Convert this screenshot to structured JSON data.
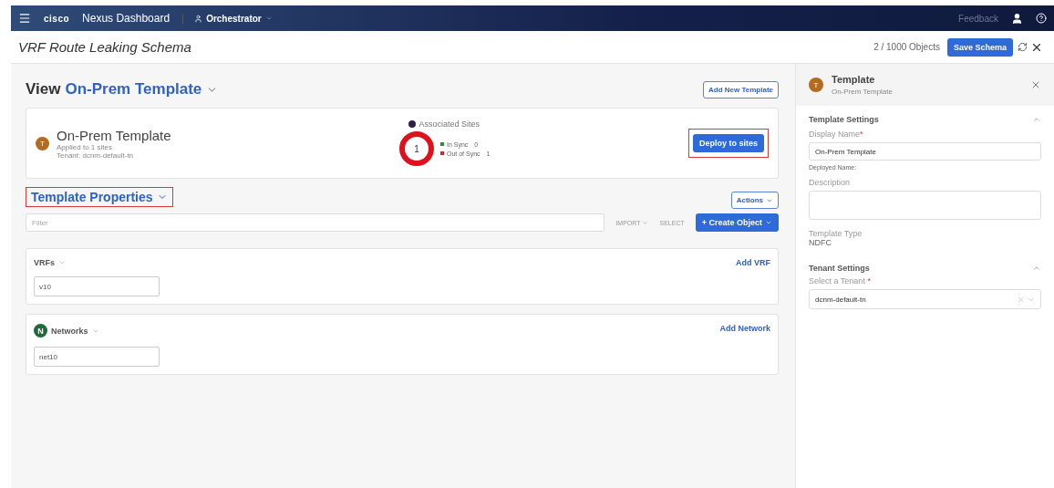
{
  "topbar": {
    "brand": "cisco",
    "product": "Nexus Dashboard",
    "app": "Orchestrator",
    "feedback": "Feedback"
  },
  "header": {
    "title": "VRF Route Leaking Schema",
    "objects": "2 / 1000 Objects",
    "save": "Save Schema"
  },
  "view": {
    "prefix": "View",
    "name": "On-Prem Template",
    "add_button": "Add New Template"
  },
  "template_card": {
    "avatar": "T",
    "name": "On-Prem Template",
    "applied": "Applied to 1 sites",
    "tenant": "Tenant: dcnm-default-tn",
    "sites_title": "Associated Sites",
    "ring_count": "1",
    "legend": [
      {
        "label": "In Sync",
        "count": "0",
        "color": "#2e8b3a"
      },
      {
        "label": "Out of Sync",
        "count": "1",
        "color": "#e0202a"
      }
    ],
    "deploy": "Deploy to sites",
    "deploy_highlighted": true
  },
  "properties": {
    "title": "Template Properties",
    "highlighted": true,
    "actions": "Actions",
    "filter_placeholder": "Filter",
    "import": "IMPORT",
    "select": "SELECT",
    "create": "+ Create Object"
  },
  "sections": [
    {
      "title": "VRFs",
      "add": "Add VRF",
      "items": [
        "v10"
      ]
    },
    {
      "title": "Networks",
      "badge": "N",
      "add": "Add Network",
      "items": [
        "net10"
      ]
    }
  ],
  "panel": {
    "avatar": "T",
    "title": "Template",
    "subtitle": "On-Prem Template",
    "template_settings": {
      "title": "Template Settings",
      "expanded": true,
      "display_label": "Display Name",
      "display_required": "*",
      "display_value": "On-Prem Template",
      "deployed_label": "Deployed Name:",
      "description_label": "Description",
      "type_label": "Template Type",
      "type_value": "NDFC"
    },
    "tenant_settings": {
      "title": "Tenant Settings",
      "expanded": true,
      "select_label": "Select a Tenant",
      "select_required": "*",
      "select_value": "dcnm-default-tn"
    }
  }
}
